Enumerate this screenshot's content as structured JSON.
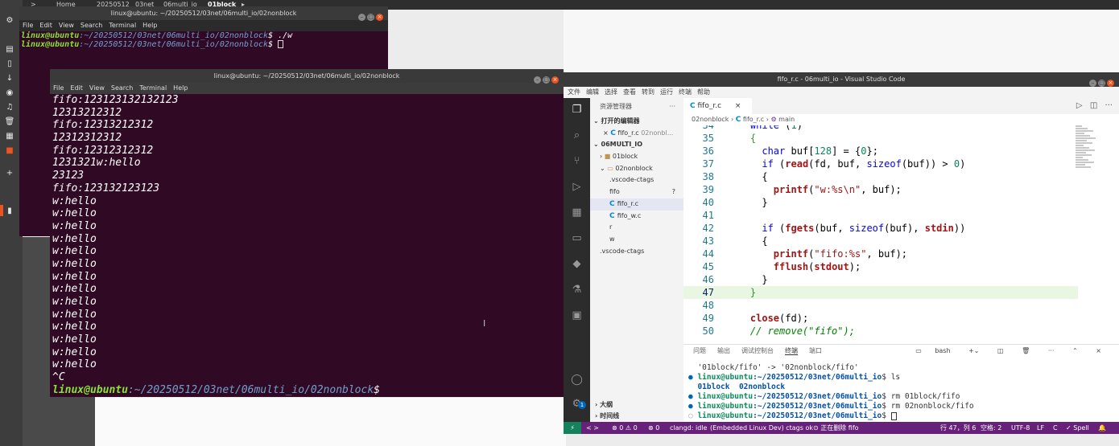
{
  "desktop": {
    "path_bar": [
      "<",
      ">",
      "Home",
      "20250512",
      "03net",
      "06multi_io",
      "01block",
      "▸"
    ],
    "active_crumb_index": 6,
    "dock_icons": [
      "settings-icon",
      "files-icon",
      "document-icon",
      "download-icon",
      "camera-icon",
      "music-icon",
      "trash-icon",
      "calendar-icon",
      "app-icon",
      "add-icon",
      "terminal-icon"
    ],
    "dock_glyphs": [
      "⚙",
      "▤",
      "▯",
      "↓",
      "◉",
      "♫",
      "🗑",
      "▦",
      "■",
      "+",
      "▮"
    ]
  },
  "terminal_back": {
    "title": "linux@ubuntu: ~/20250512/03net/06multi_io/02nonblock",
    "menu": [
      "File",
      "Edit",
      "View",
      "Search",
      "Terminal",
      "Help"
    ],
    "lines": [
      {
        "user": "linux@ubuntu",
        "path": ":~/20250512/03net/06multi_io/02nonblock",
        "cmd": "$ ./w",
        "cursor": false
      },
      {
        "user": "linux@ubuntu",
        "path": ":~/20250512/03net/06multi_io/02nonblock",
        "cmd": "$ ",
        "cursor": true
      }
    ]
  },
  "terminal_front": {
    "title": "linux@ubuntu: ~/20250512/03net/06multi_io/02nonblock",
    "menu": [
      "File",
      "Edit",
      "View",
      "Search",
      "Terminal",
      "Help"
    ],
    "output": [
      "fifo:123123132132123",
      "12313212312",
      "fifo:12313212312",
      "12312312312",
      "fifo:12312312312",
      "1231321w:hello",
      "23123",
      "fifo:123132123123",
      "w:hello",
      "w:hello",
      "w:hello",
      "w:hello",
      "w:hello",
      "w:hello",
      "w:hello",
      "w:hello",
      "w:hello",
      "w:hello",
      "w:hello",
      "w:hello",
      "w:hello",
      "w:hello",
      "^C"
    ],
    "prompt_user": "linux@ubuntu",
    "prompt_path": ":~/20250512/03net/06multi_io/02nonblock",
    "prompt_end": "$"
  },
  "vscode": {
    "title": "fifo_r.c - 06multi_io - Visual Studio Code",
    "menu": [
      "文件",
      "编辑",
      "选择",
      "查看",
      "转到",
      "运行",
      "终端",
      "帮助"
    ],
    "explorer": {
      "header": "资源管理器",
      "more": "···",
      "open_editors": "打开的编辑器",
      "open_file": "fifo_r.c",
      "open_file_dir": "02nonbl...",
      "root": "06MULTI_IO",
      "tree": [
        {
          "label": "01block",
          "kind": "folder-closed",
          "indent": 1
        },
        {
          "label": "02nonblock",
          "kind": "folder-open",
          "indent": 1
        },
        {
          "label": ".vscode-ctags",
          "kind": "file",
          "indent": 2
        },
        {
          "label": "fifo",
          "kind": "file",
          "indent": 2,
          "badge": "?"
        },
        {
          "label": "fifo_r.c",
          "kind": "c",
          "indent": 2,
          "selected": true
        },
        {
          "label": "fifo_w.c",
          "kind": "c",
          "indent": 2
        },
        {
          "label": "r",
          "kind": "file",
          "indent": 2
        },
        {
          "label": "w",
          "kind": "file",
          "indent": 2
        },
        {
          "label": ".vscode-ctags",
          "kind": "file",
          "indent": 1
        }
      ],
      "outline": "大纲",
      "timeline": "时间线"
    },
    "tab": {
      "label": "fifo_r.c",
      "close": "×"
    },
    "breadcrumb": [
      "02nonblock",
      "fifo_r.c",
      "main"
    ],
    "code": [
      {
        "n": "34",
        "html": "    <span class='kw'>while</span> (<span class='num'>1</span>)"
      },
      {
        "n": "35",
        "html": "    <span class='br'>{</span>"
      },
      {
        "n": "36",
        "html": "      <span class='ty'>char</span> <span class='id'>buf</span>[<span class='num'>128</span>] = {<span class='num'>0</span>};"
      },
      {
        "n": "37",
        "html": "      <span class='kw'>if</span> (<span class='fnb'>read</span>(<span class='id'>fd</span>, <span class='id'>buf</span>, <span class='kw'>sizeof</span>(<span class='id'>buf</span>)) &gt; <span class='num'>0</span>)"
      },
      {
        "n": "38",
        "html": "      {"
      },
      {
        "n": "39",
        "html": "        <span class='fnb'>printf</span>(<span class='str'>\"w:%s\\n\"</span>, <span class='id'>buf</span>);"
      },
      {
        "n": "40",
        "html": "      }"
      },
      {
        "n": "41",
        "html": ""
      },
      {
        "n": "42",
        "html": "      <span class='kw'>if</span> (<span class='fnb'>fgets</span>(<span class='id'>buf</span>, <span class='kw'>sizeof</span>(<span class='id'>buf</span>), <span class='fnb'>stdin</span>))"
      },
      {
        "n": "43",
        "html": "      {"
      },
      {
        "n": "44",
        "html": "        <span class='fnb'>printf</span>(<span class='str'>\"fifo:%s\"</span>, <span class='id'>buf</span>);"
      },
      {
        "n": "45",
        "html": "        <span class='fnb'>fflush</span>(<span class='fnb'>stdout</span>);"
      },
      {
        "n": "46",
        "html": "      }"
      },
      {
        "n": "47",
        "html": "    <span class='br'>}</span>",
        "current": true
      },
      {
        "n": "48",
        "html": ""
      },
      {
        "n": "49",
        "html": "    <span class='fnb'>close</span>(<span class='id'>fd</span>);"
      },
      {
        "n": "50",
        "html": "    <span class='cm'>// remove(\"fifo\");</span>"
      }
    ],
    "panel_tabs": [
      "问题",
      "输出",
      "调试控制台",
      "终端",
      "端口"
    ],
    "panel_active": 3,
    "panel_shell": "bash",
    "terminal_lines": [
      {
        "dot": "",
        "html": "'01block/fifo' -&gt; '02nonblock/fifo'"
      },
      {
        "dot": "b",
        "user": "linux@ubuntu",
        "path": ":~/20250512/03net/06multi_io",
        "cmd": "$ ls"
      },
      {
        "dot": "",
        "html": "<span class='tdir'>01block</span>  <span class='tdir'>02nonblock</span>"
      },
      {
        "dot": "b",
        "user": "linux@ubuntu",
        "path": ":~/20250512/03net/06multi_io",
        "cmd": "$ rm 01block/fifo"
      },
      {
        "dot": "b",
        "user": "linux@ubuntu",
        "path": ":~/20250512/03net/06multi_io",
        "cmd": "$ rm 02nonblock/fifo"
      },
      {
        "dot": "h",
        "user": "linux@ubuntu",
        "path": ":~/20250512/03net/06multi_io",
        "cmd": "$ ",
        "cursor": true
      }
    ],
    "status": {
      "remote": "⚡",
      "nav": "<  >",
      "problems": "⊗ 0 ⚠ 0",
      "ports": "⊗ 0",
      "clangd": "clangd: idle",
      "ctags": "(Embedded Linux Dev) ctags ok",
      "deleting": "⊙ 正在删除 fifo",
      "position": "行 47，列 6",
      "spaces": "空格: 2",
      "encoding": "UTF-8",
      "eol": "LF",
      "lang": "C",
      "spell": "✓ Spell",
      "bell": "🔔"
    },
    "colors": {
      "status_bg": "#68217a",
      "accent": "#0066b8",
      "terminal_bg": "#300a24"
    }
  }
}
